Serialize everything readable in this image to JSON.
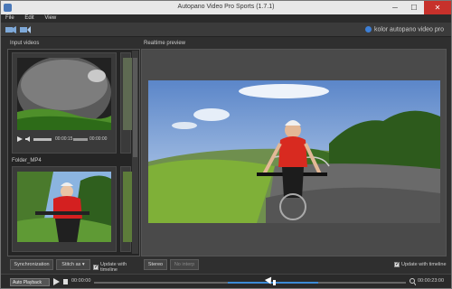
{
  "window": {
    "title": "Autopano Video Pro Sports (1.7.1)",
    "min_icon": "minimize-icon",
    "max_icon": "maximize-icon",
    "close_icon": "close-icon"
  },
  "menu": {
    "items": [
      "File",
      "Edit",
      "View"
    ]
  },
  "toolbar": {
    "icons": [
      "import-video-icon",
      "export-icon"
    ],
    "brand": "kolor autopano video pro"
  },
  "input_videos": {
    "title": "Input videos",
    "clips": [
      {
        "timecode": "00:00:15",
        "duration": "00:00:00",
        "filename": ""
      },
      {
        "timecode": "",
        "duration": "",
        "filename": "Folder_MP4"
      }
    ],
    "buttons": {
      "synchronization": "Synchronization",
      "stitch_as": "Stitch as ▾",
      "update_timeline": "Update with timeline"
    }
  },
  "preview": {
    "title": "Realtime preview",
    "buttons": {
      "stereo": "Stereo",
      "no_interp": "No interp"
    },
    "checkbox": "Update with timeline"
  },
  "bottom": {
    "select_value": "Auto Playback",
    "time_start": "00:00:00",
    "time_end": "00:00:23:00",
    "progress": 0.48
  },
  "colors": {
    "accent": "#3d8bd6",
    "close": "#c7312b"
  }
}
